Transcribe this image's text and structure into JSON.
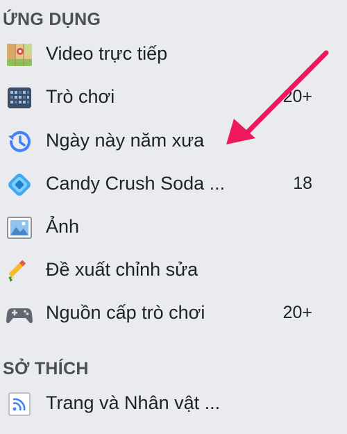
{
  "sections": {
    "apps": {
      "title": "ỨNG DỤNG",
      "items": [
        {
          "label": "Video trực tiếp",
          "count": "",
          "icon": "live-video-map-icon"
        },
        {
          "label": "Trò chơi",
          "count": "20+",
          "icon": "games-grid-icon"
        },
        {
          "label": "Ngày này năm xưa",
          "count": "",
          "icon": "memories-clock-icon"
        },
        {
          "label": "Candy Crush Soda ...",
          "count": "18",
          "icon": "candy-crush-icon"
        },
        {
          "label": "Ảnh",
          "count": "",
          "icon": "photo-icon"
        },
        {
          "label": "Đề xuất chỉnh sửa",
          "count": "",
          "icon": "pencil-icon"
        },
        {
          "label": "Nguồn cấp trò chơi",
          "count": "20+",
          "icon": "gamepad-icon"
        }
      ]
    },
    "interests": {
      "title": "SỞ THÍCH",
      "items": [
        {
          "label": "Trang và Nhân vật ...",
          "count": "",
          "icon": "rss-feed-icon"
        }
      ]
    }
  },
  "annotation": {
    "arrow_color": "#f0185c",
    "points_to": "Ngày này năm xưa"
  },
  "colors": {
    "background": "#e9ebee",
    "header_text": "#4b4f56",
    "item_text": "#1d2129",
    "memories_blue": "#4080ff"
  }
}
